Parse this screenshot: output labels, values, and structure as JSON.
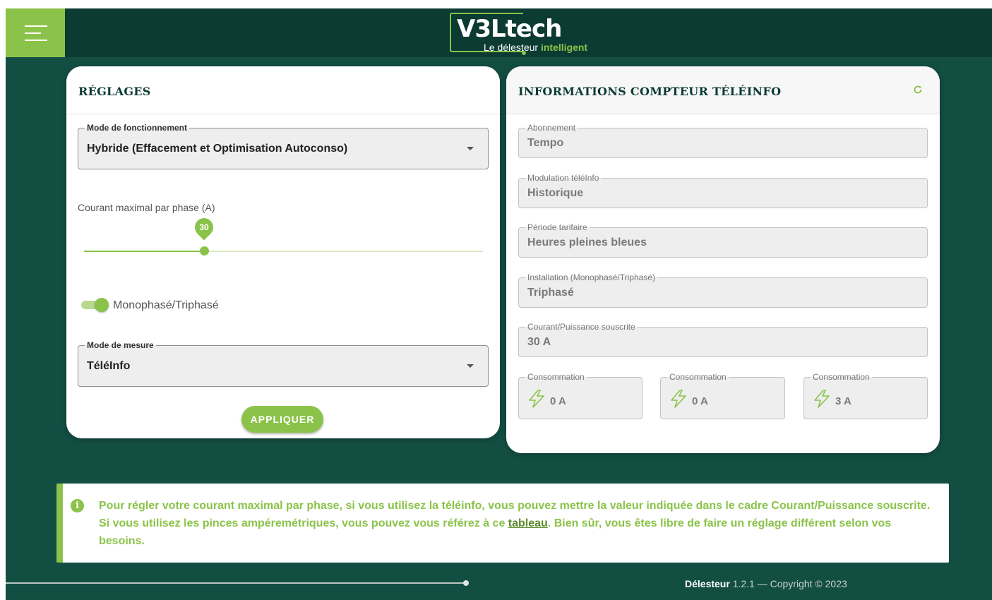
{
  "header": {
    "menu_icon": "hamburger-icon",
    "logo_main": "V3Ltech",
    "logo_sub_plain": "Le délesteur",
    "logo_sub_accent": "intelligent"
  },
  "settings": {
    "title": "RÉGLAGES",
    "mode": {
      "label": "Mode de fonctionnement",
      "value": "Hybride (Effacement et Optimisation Autoconso)"
    },
    "current": {
      "label": "Courant maximal par phase (A)",
      "value": "30",
      "fraction": 0.3
    },
    "phase_toggle": {
      "label": "Monophasé/Triphasé",
      "checked": true
    },
    "measure": {
      "label": "Mode de mesure",
      "value": "TéléInfo"
    },
    "apply_label": "APPLIQUER"
  },
  "meter": {
    "title": "INFORMATIONS COMPTEUR TÉLÉINFO",
    "refresh_icon": "refresh-icon",
    "fields": [
      {
        "label": "Abonnement",
        "value": "Tempo"
      },
      {
        "label": "Modulation téléInfo",
        "value": "Historique"
      },
      {
        "label": "Période tarifaire",
        "value": "Heures pleines bleues"
      },
      {
        "label": "Installation (Monophasé/Triphasé)",
        "value": "Triphasé"
      },
      {
        "label": "Courant/Puissance souscrite",
        "value": "30 A"
      }
    ],
    "consumption": [
      {
        "label": "Consommation",
        "value": "0 A",
        "icon": "lightning-icon"
      },
      {
        "label": "Consommation",
        "value": "0 A",
        "icon": "lightning-icon"
      },
      {
        "label": "Consommation",
        "value": "3 A",
        "icon": "lightning-icon"
      }
    ]
  },
  "alert": {
    "icon": "info-icon",
    "text_before": "Pour régler votre courant maximal par phase, si vous utilisez la téléinfo, vous pouvez mettre la valeur indiquée dans le cadre Courant/Puissance souscrite. Si vous utilisez les pinces ampéremétriques, vous pouvez vous référez à ce ",
    "link_text": "tableau",
    "text_after": ". Bien sûr, vous êtes libre de faire un réglage différent selon vos besoins."
  },
  "footer": {
    "app_name": "Délesteur",
    "version_copyright": " 1.2.1 — Copyright © 2023"
  },
  "colors": {
    "accent": "#8bc34a",
    "background": "#134e43",
    "topbar": "#0b3b32"
  }
}
